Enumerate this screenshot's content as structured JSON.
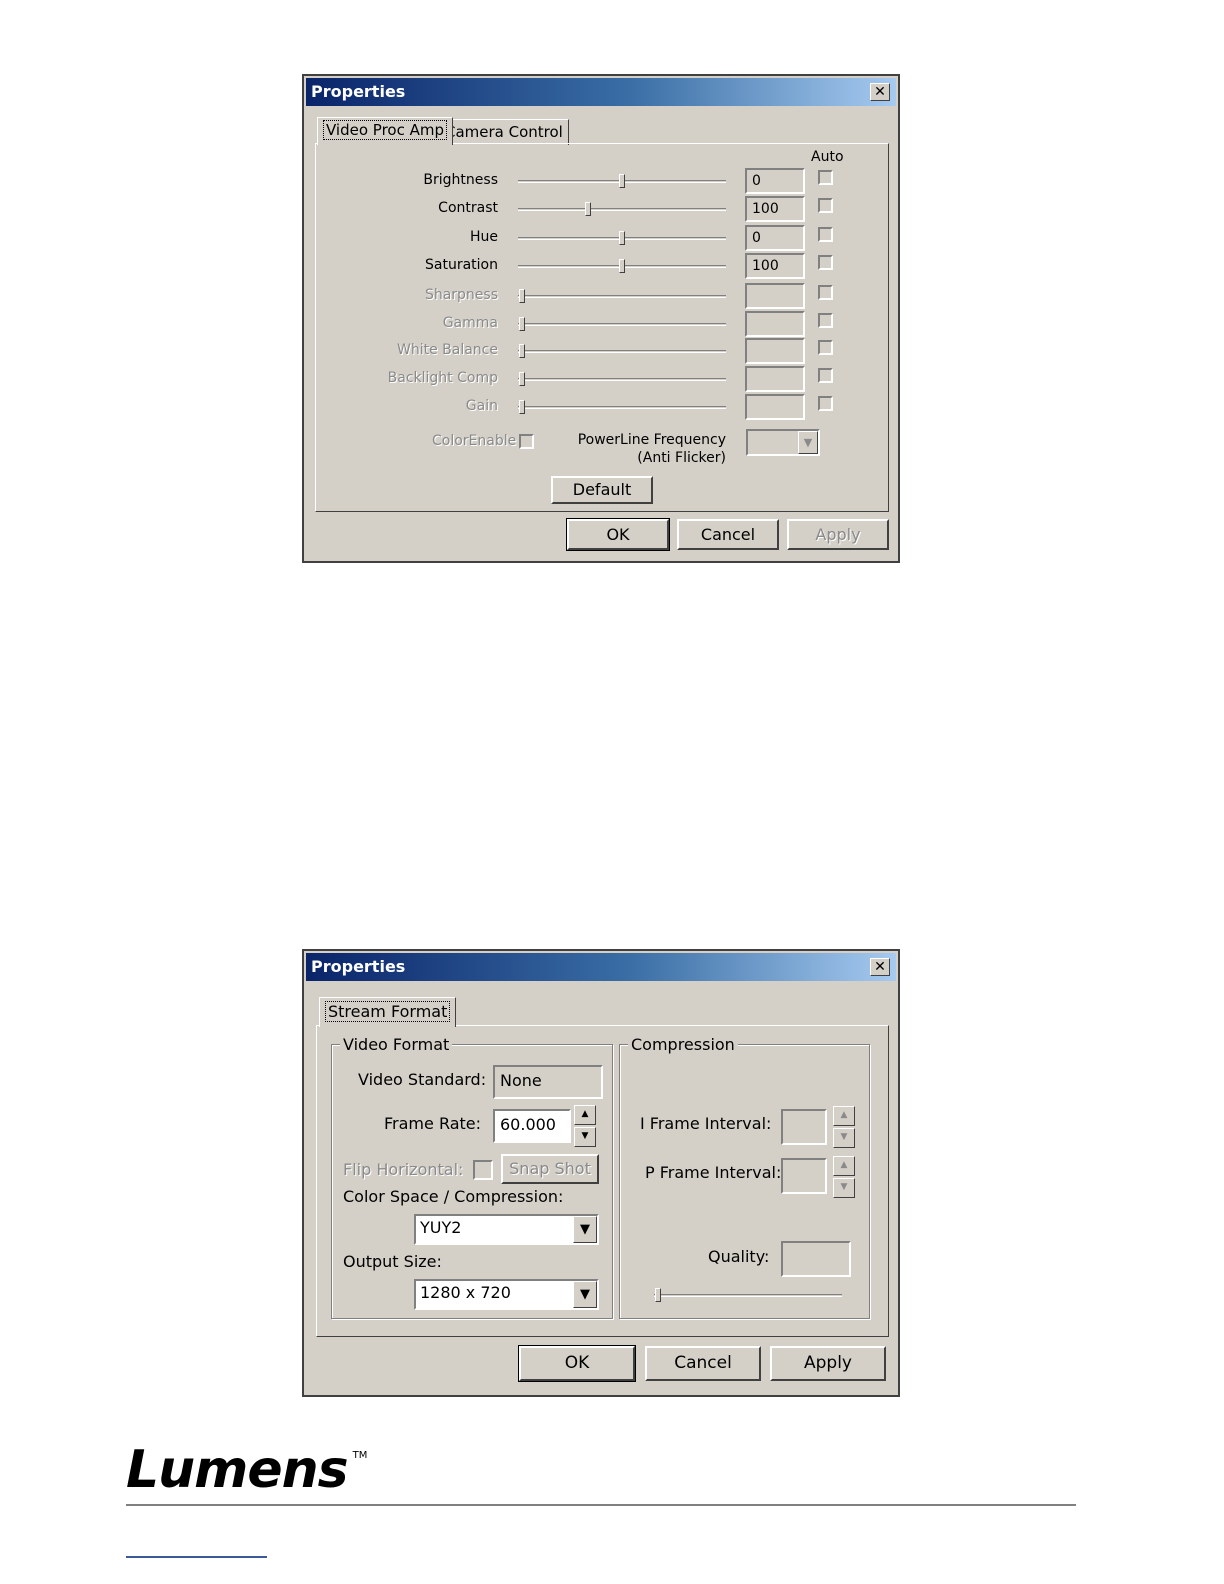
{
  "dialog1": {
    "title": "Properties",
    "close": "✕",
    "tabs": [
      "Video Proc Amp",
      "Camera Control"
    ],
    "auto_header": "Auto",
    "rows": [
      {
        "label": "Brightness",
        "value": "0",
        "slider": 0.5,
        "enabled": true
      },
      {
        "label": "Contrast",
        "value": "100",
        "slider": 0.33,
        "enabled": true
      },
      {
        "label": "Hue",
        "value": "0",
        "slider": 0.5,
        "enabled": true
      },
      {
        "label": "Saturation",
        "value": "100",
        "slider": 0.5,
        "enabled": true
      },
      {
        "label": "Sharpness",
        "value": "",
        "slider": 0.0,
        "enabled": false
      },
      {
        "label": "Gamma",
        "value": "",
        "slider": 0.0,
        "enabled": false
      },
      {
        "label": "White Balance",
        "value": "",
        "slider": 0.0,
        "enabled": false
      },
      {
        "label": "Backlight Comp",
        "value": "",
        "slider": 0.0,
        "enabled": false
      },
      {
        "label": "Gain",
        "value": "",
        "slider": 0.0,
        "enabled": false
      }
    ],
    "color_enable": "ColorEnable",
    "powerline_line1": "PowerLine Frequency",
    "powerline_line2": "(Anti Flicker)",
    "default_button": "Default",
    "ok": "OK",
    "cancel": "Cancel",
    "apply": "Apply"
  },
  "dialog2": {
    "title": "Properties",
    "close": "✕",
    "tab": "Stream Format",
    "video_format": {
      "title": "Video Format",
      "video_standard_label": "Video Standard:",
      "video_standard_value": "None",
      "frame_rate_label": "Frame Rate:",
      "frame_rate_value": "60.000",
      "flip_horizontal": "Flip Horizontal:",
      "snap_shot": "Snap Shot",
      "color_space_label": "Color Space / Compression:",
      "color_space_value": "YUY2",
      "output_size_label": "Output Size:",
      "output_size_value": "1280 x 720"
    },
    "compression": {
      "title": "Compression",
      "i_frame_label": "I Frame Interval:",
      "p_frame_label": "P Frame Interval:",
      "quality_label": "Quality:",
      "quality_slider": 0.0
    },
    "ok": "OK",
    "cancel": "Cancel",
    "apply": "Apply"
  },
  "footer": {
    "logo": "Lumens",
    "trademark": "TM"
  }
}
